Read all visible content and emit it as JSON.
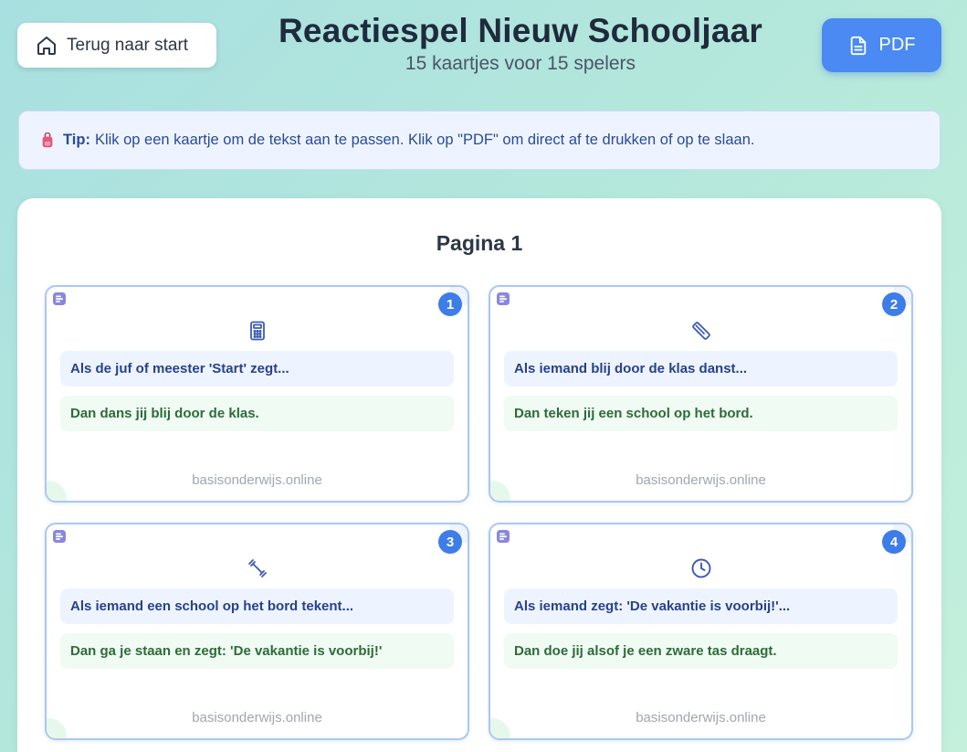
{
  "header": {
    "back_label": "Terug naar start",
    "title": "Reactiespel Nieuw Schooljaar",
    "subtitle": "15 kaartjes voor 15 spelers",
    "pdf_label": "PDF"
  },
  "tip": {
    "label": "Tip:",
    "text": "Klik op een kaartje om de tekst aan te passen. Klik op \"PDF\" om direct af te drukken of op te slaan."
  },
  "page": {
    "title": "Pagina 1"
  },
  "cards": [
    {
      "number": "1",
      "icon": "calculator-icon",
      "question": "Als de juf of meester 'Start' zegt...",
      "answer": "Dan dans jij blij door de klas.",
      "footer": "basisonderwijs.online"
    },
    {
      "number": "2",
      "icon": "ruler-icon",
      "question": "Als iemand blij door de klas danst...",
      "answer": "Dan teken jij een school op het bord.",
      "footer": "basisonderwijs.online"
    },
    {
      "number": "3",
      "icon": "dumbbell-icon",
      "question": "Als iemand een school op het bord tekent...",
      "answer": "Dan ga je staan en zegt: 'De vakantie is voorbij!'",
      "footer": "basisonderwijs.online"
    },
    {
      "number": "4",
      "icon": "clock-icon",
      "question": "Als iemand zegt: 'De vakantie is voorbij!'...",
      "answer": "Dan doe jij alsof je een zware tas draagt.",
      "footer": "basisonderwijs.online"
    }
  ],
  "colors": {
    "accent": "#4a8af2",
    "badge": "#3d7de8",
    "question_bg": "#eef4ff",
    "answer_bg": "#f0fbf3"
  }
}
